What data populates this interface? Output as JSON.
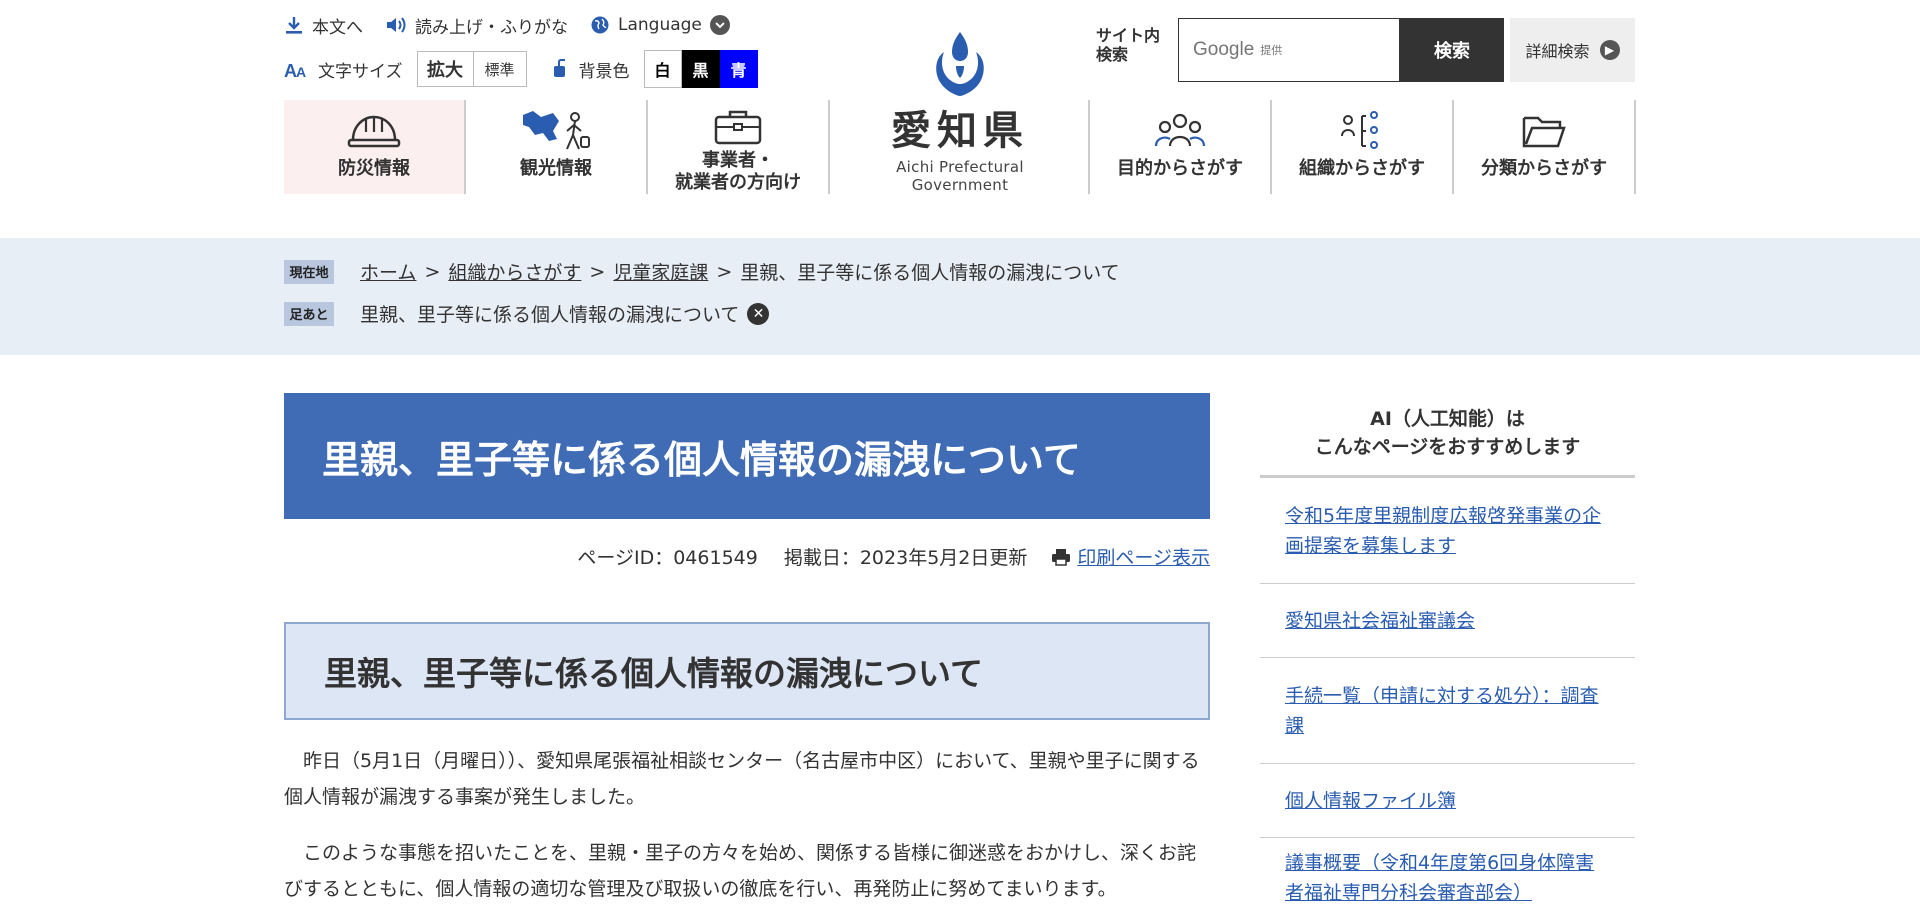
{
  "utility": {
    "honbun": "本文へ",
    "yomiage": "読み上げ・ふりがな",
    "language": "Language",
    "moji_size_label": "文字サイズ",
    "size_large": "拡大",
    "size_standard": "標準",
    "bg_label": "背景色",
    "bg_white": "白",
    "bg_black": "黒",
    "bg_blue": "青"
  },
  "logo": {
    "jp": "愛知県",
    "en": "Aichi Prefectural Government"
  },
  "search": {
    "label_line1": "サイト内",
    "label_line2": "検索",
    "google_text": "Google",
    "provided": "提供",
    "button": "検索",
    "advanced": "詳細検索"
  },
  "nav": {
    "left": [
      {
        "label": "防災情報",
        "icon": "helmet-icon"
      },
      {
        "label": "観光情報",
        "icon": "tourism-icon"
      },
      {
        "label_line1": "事業者・",
        "label_line2": "就業者の方向け",
        "icon": "briefcase-icon"
      }
    ],
    "right": [
      {
        "label": "目的からさがす",
        "icon": "people-icon"
      },
      {
        "label": "組織からさがす",
        "icon": "organization-icon"
      },
      {
        "label": "分類からさがす",
        "icon": "folder-icon"
      }
    ]
  },
  "breadcrumb": {
    "current_tag": "現在地",
    "items": [
      "ホーム",
      "組織からさがす",
      "児童家庭課"
    ],
    "current": "里親、里子等に係る個人情報の漏洩について",
    "history_tag": "足あと",
    "history_item": "里親、里子等に係る個人情報の漏洩について"
  },
  "page": {
    "title": "里親、里子等に係る個人情報の漏洩について",
    "page_id": "ページID：0461549",
    "posted": "掲載日：2023年5月2日更新",
    "print": "印刷ページ表示",
    "heading": "里親、里子等に係る個人情報の漏洩について",
    "para1": "昨日（5月1日（月曜日））、愛知県尾張福祉相談センター（名古屋市中区）において、里親や里子に関する個人情報が漏洩する事案が発生しました。",
    "para2": "このような事態を招いたことを、里親・里子の方々を始め、関係する皆様に御迷惑をおかけし、深くお詫びするとともに、個人情報の適切な管理及び取扱いの徹底を行い、再発防止に努めてまいります。"
  },
  "aside": {
    "head_line1": "AI（人工知能）は",
    "head_line2": "こんなページをおすすめします",
    "links": [
      "令和5年度里親制度広報啓発事業の企画提案を募集します",
      "愛知県社会福祉審議会",
      "手続一覧（申請に対する処分）：調査課",
      "個人情報ファイル簿",
      "議事概要（令和4年度第6回身体障害者福祉専門分科会審査部会）"
    ]
  },
  "colors": {
    "title_band": "#3f6cb5",
    "breadcrumb_band": "#e8eef5",
    "link": "#2a5db0",
    "h2_bg": "#dde6f4"
  }
}
